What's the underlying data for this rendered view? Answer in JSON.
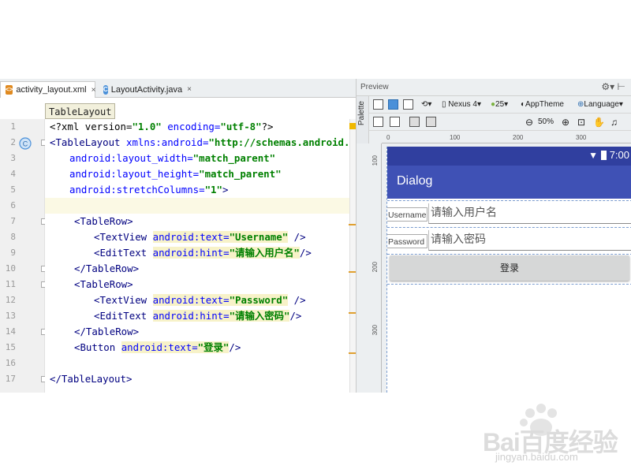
{
  "editor": {
    "tabs": [
      {
        "label": "activity_layout.xml",
        "close": "×"
      },
      {
        "label": "LayoutActivity.java",
        "close": "×"
      }
    ],
    "breadcrumb": "TableLayout",
    "line_numbers": [
      "1",
      "2",
      "3",
      "4",
      "5",
      "6",
      "7",
      "8",
      "9",
      "10",
      "11",
      "12",
      "13",
      "14",
      "15",
      "16",
      "17"
    ]
  },
  "code": {
    "l1": {
      "a": "<?xml version=",
      "b": "\"1.0\"",
      "c": " encoding=",
      "d": "\"utf-8\"",
      "e": "?>"
    },
    "l2": {
      "a": "<TableLayout ",
      "b": "xmlns:android=",
      "c": "\"http://schemas.android.com"
    },
    "l3": {
      "a": "android:layout_width=",
      "b": "\"match_parent\""
    },
    "l4": {
      "a": "android:layout_height=",
      "b": "\"match_parent\""
    },
    "l5": {
      "a": "android:stretchColumns=",
      "b": "\"1\"",
      "c": ">"
    },
    "l7": "<TableRow>",
    "l8": {
      "a": "<TextView ",
      "b": "android:text=",
      "c": "\"Username\"",
      "d": " />"
    },
    "l9": {
      "a": "<EditText ",
      "b": "android:hint=",
      "c": "\"请输入用户名\"",
      "d": "/>"
    },
    "l10": "</TableRow>",
    "l11": "<TableRow>",
    "l12": {
      "a": "<TextView ",
      "b": "android:text=",
      "c": "\"Password\"",
      "d": " />"
    },
    "l13": {
      "a": "<EditText ",
      "b": "android:hint=",
      "c": "\"请输入密码\"",
      "d": "/>"
    },
    "l14": "</TableRow>",
    "l15": {
      "a": "<Button ",
      "b": "android:text=",
      "c": "\"登录\"",
      "d": "/>"
    },
    "l17": "</TableLayout>"
  },
  "preview": {
    "title": "Preview",
    "palette": "Palette",
    "device": "Nexus 4",
    "api": "25",
    "theme": "AppTheme",
    "language": "Language",
    "zoom": "50%",
    "ruler_top": [
      "0",
      "100",
      "200",
      "300"
    ],
    "ruler_left": [
      "100",
      "200",
      "300"
    ],
    "app": {
      "time": "7:00",
      "title": "Dialog",
      "username_label": "Username",
      "username_hint": "请输入用户名",
      "password_label": "Password",
      "password_hint": "请输入密码",
      "login_button": "登录"
    }
  },
  "watermark": {
    "brand": "Bai百度经验",
    "url": "jingyan.baidu.com"
  },
  "colors": {
    "status_bar": "#303f9f",
    "app_bar": "#3f51b5",
    "button": "#d6d7d7"
  }
}
